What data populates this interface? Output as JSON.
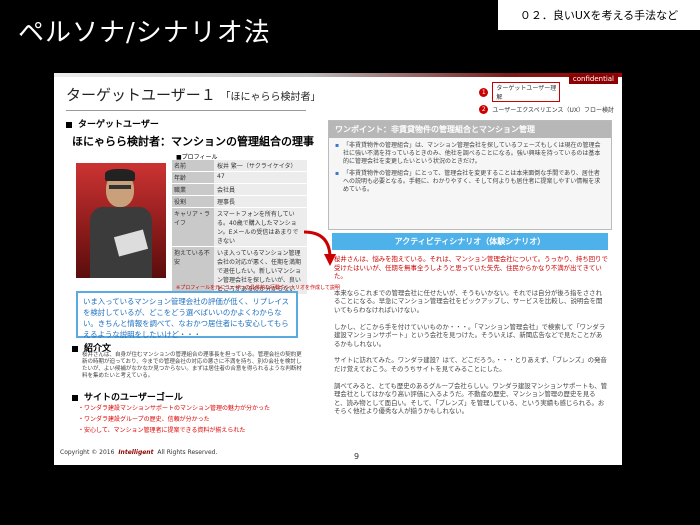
{
  "header": {
    "title": "ペルソナ/シナリオ法",
    "corner_tag": "０２．良いUXを考える手法など"
  },
  "slide": {
    "confidential": "confidential",
    "heading": "ターゲットユーザー１",
    "heading_sub": "「ほにゃらら検討者」",
    "legend": [
      {
        "num": "1",
        "label": "ターゲットユーザー理解"
      },
      {
        "num": "2",
        "label": "ユーザーエクスペリエンス（UX）フロー検討"
      }
    ],
    "target_section": "ターゲットユーザー",
    "persona_title": "ほにゃらら検討者：マンションの管理組合の理事",
    "profile_label": "■プロフィール",
    "profile": [
      {
        "k": "名前",
        "v": "桜井 繁一（サクライケイタ）"
      },
      {
        "k": "年齢",
        "v": "47"
      },
      {
        "k": "職業",
        "v": "会社員"
      },
      {
        "k": "役割",
        "v": "理事長"
      },
      {
        "k": "キャリア・ライフ",
        "v": "スマートフォンを所有している。40歳で購入したマンション。Eメールの受信はあまりできない"
      },
      {
        "k": "抱えている不安",
        "v": "いま入っているマンション管理会社の対応が悪く、任期を満期で退任したい。新しいマンション管理会社を探したいが、良いところがあるのか分からない"
      }
    ],
    "profile_caption": "※プロフィールを元にユーザーの具体的な行動やシナリオを作成して説明",
    "quote": "いま入っているマンション管理会社の評価が低く、リプレイスを検討しているが、どこをどう選べばいいのかよくわからない。きちんと情報を調べて、なおかつ居住者にも安心してもらえるような説明をしたいけど・・・",
    "intro_head": "紹介文",
    "intro_text": "桜井さんは、自身が住むマンションの管理組合の理事長を担っている。管理会社の契約更新の時期が迫っており、今までの管理会社の対応の悪さに不満を持ち、別の会社を検討したいが、よい候補がなかなか見つからない。まずは居住者の合意を得られるような判断材料を集めたいと考えている。",
    "goal_head": "サイトのユーザーゴール",
    "goals": [
      "・ワンダラ建設マンションサポートのマンション管理の魅力が分かった",
      "・ワンダラ建設グループの歴史、信頼が分かった",
      "・安心して、マンション管理者に提案できる資料が揃えられた"
    ],
    "onepoint_head": "ワンポイント：非賃貸物件の管理組合とマンション管理",
    "onepoint_p1": "「非賃貸物件の管理組合」は、マンション管理会社を探しているフェーズもしくは現在の管理会社に強い不満を持っているときのみ、他社を調べることになる。強い興味を持っているのは基本的に管理会社を変更したいという状況のときだけ。",
    "onepoint_p2": "「非賃貸物件の管理組合」にとって、管理会社を変更することは本来面倒な手間であり、居住者への説明も必要となる。手軽に、わかりやすく、そして何よりも居住者に提案しやすい情報を求めている。",
    "activity_btn": "アクティビティシナリオ（体験シナリオ）",
    "scenario": [
      "桜井さんは、悩みを抱えている。それは、マンション管理会社について。うっかり、持ち回りで受けたはいいが、任期を無事全うしようと思っていた矢先、住民からかなり不満が出てきていた。",
      "本来ならこれまでの管理会社に任せたいが、そうもいかない。それでは自分が後ろ指をさされることになる。早急にマンション管理会社をピックアップし、サービスを比較し、説明会を開いてもらわなければいけない。",
      "しかし、どこから手を付けていいものか・・・。「マンション管理会社」で検索して「ワンダラ建設マンションサポート」という会社を見つけた。そういえば、新聞広告などで見たことがあるかもしれない。",
      "サイトに訪れてみた。ワンダラ建設？はて、どこだろう。・・・とりあえず、「ブレンズ」の発音だけ覚えておこう。そのうちサイトを見てみることにした。",
      "調べてみると、とても歴史のあるグループ会社らしい。ワンダラ建設マンションサポートも、管理会社としてはかなり高い評価に入るようだ。不動産の歴史、マンション管理の歴史を見ると、読み物として面白い。そして、「ブレンズ」を管理している、という実績も感じられる。おそらく他社より優秀な人が揃うかもしれない。"
    ],
    "copyright": "Copyright © 2016",
    "logo_text": "Intelligent",
    "rights": "All Rights Reserved.",
    "page_number": "9"
  },
  "colors": {
    "accent_blue": "#4eb1ea",
    "quote_blue": "#1a6fc0",
    "goal_red": "#dd0000"
  }
}
